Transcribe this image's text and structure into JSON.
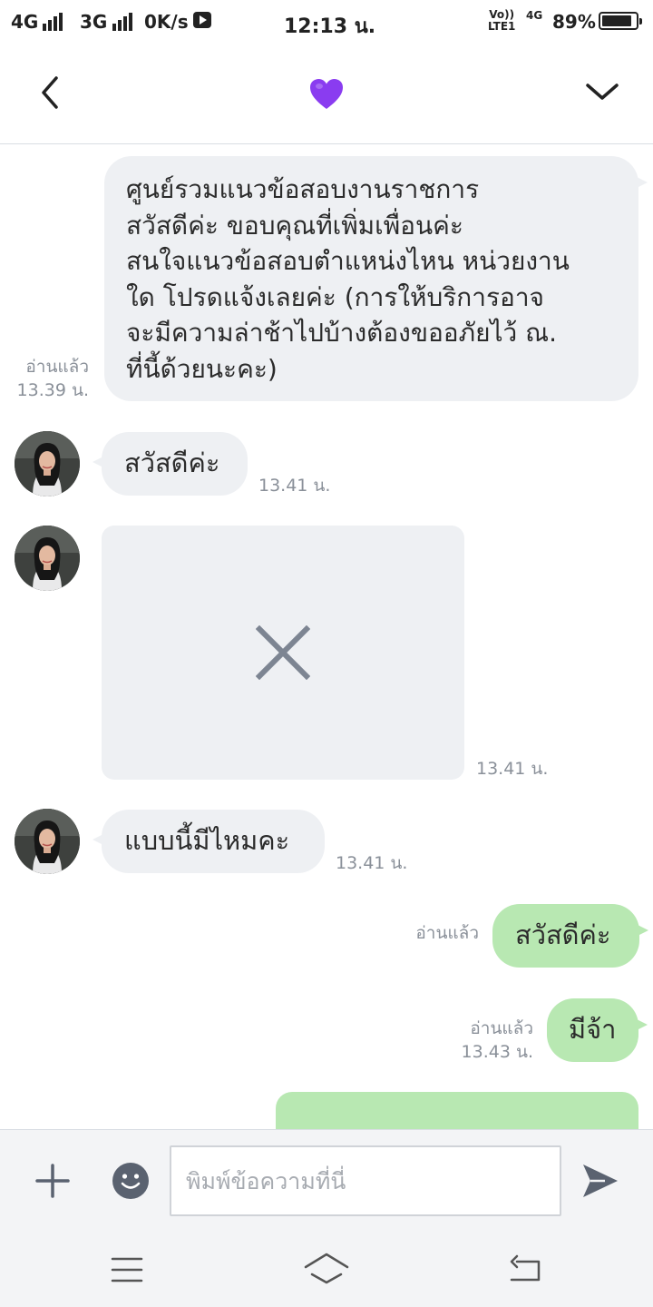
{
  "status_bar": {
    "net1": "4G",
    "net2": "3G",
    "speed": "0K/s",
    "time": "12:13 น.",
    "volte_line1": "Vo))",
    "volte_line2": "LTE1",
    "net3": "4G",
    "battery_percent": "89%",
    "battery_level": 0.89
  },
  "header": {
    "back_icon": "back-chevron-icon",
    "title_icon": "purple-heart-icon",
    "title_color": "#8a3cf0",
    "menu_icon": "chevron-down-icon"
  },
  "messages": [
    {
      "direction": "outgoing",
      "lines": [
        "ศูนย์รวมแนวข้อสอบงานราชการ",
        "สวัสดีค่ะ  ขอบคุณที่เพิ่มเพื่อนค่ะ",
        "สนใจแนวข้อสอบตำแหน่งไหน หน่วยงาน",
        "ใด โปรดแจ้งเลยค่ะ  (การให้บริการอาจ",
        "จะมีความล่าช้าไปบ้างต้องขออภัยไว้ ณ.",
        "ที่นี้ด้วยนะคะ)"
      ],
      "read": "อ่านแล้ว",
      "time": "13.39 น."
    },
    {
      "direction": "incoming",
      "text": "สวัสดีค่ะ",
      "time": "13.41 น."
    },
    {
      "direction": "incoming",
      "type": "image-unavailable",
      "icon": "close-icon",
      "time": "13.41 น."
    },
    {
      "direction": "incoming",
      "text": "แบบนี้มีไหมคะ",
      "time": "13.41 น."
    },
    {
      "direction": "outgoing",
      "text": "สวัสดีค่ะ",
      "read": "อ่านแล้ว"
    },
    {
      "direction": "outgoing",
      "text": "มีจ้า",
      "read": "อ่านแล้ว",
      "time": "13.43 น."
    }
  ],
  "composer": {
    "placeholder": "พิมพ์ข้อความที่นี่",
    "add_icon": "plus-icon",
    "emoji_icon": "emoji-icon",
    "send_icon": "send-icon"
  },
  "colors": {
    "incoming_bubble": "#eef0f3",
    "outgoing_bubble": "#b8e8b2",
    "icon_gray": "#5a6270"
  }
}
